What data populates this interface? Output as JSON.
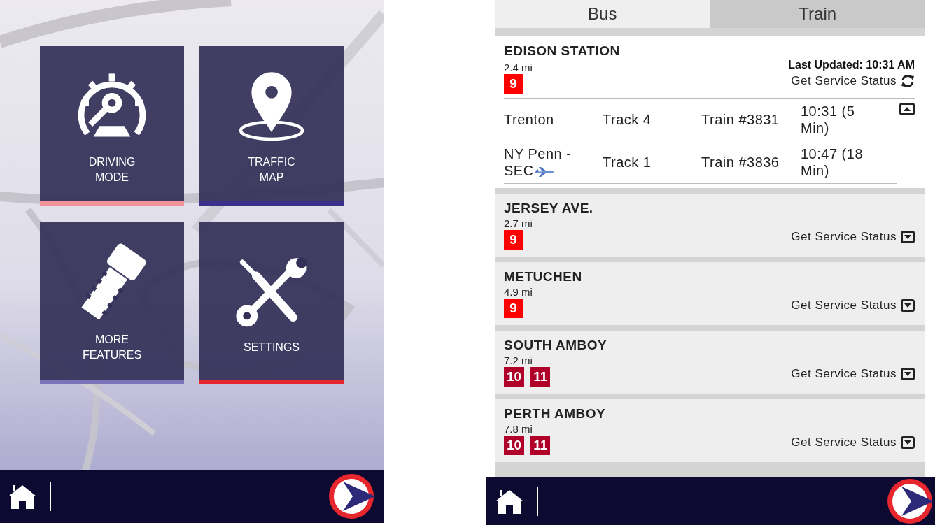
{
  "home_screen": {
    "tiles": [
      {
        "kind": "driving_mode",
        "label": "DRIVING\nMODE",
        "color": "#f0949a"
      },
      {
        "kind": "traffic_map",
        "label": "TRAFFIC\nMAP",
        "color": "#3a2f8c"
      },
      {
        "kind": "more_features",
        "label": "MORE\nFEATURES",
        "color": "#7b72b8"
      },
      {
        "kind": "settings",
        "label": "SETTINGS",
        "color": "#e8262e"
      }
    ]
  },
  "transit_screen": {
    "tabs": [
      {
        "label": "Bus",
        "selected": false
      },
      {
        "label": "Train",
        "selected": true
      }
    ],
    "stations": [
      {
        "name": "EDISON STATION",
        "distance": "2.4 mi",
        "expanded": true,
        "last_updated": "Last Updated: 10:31 AM",
        "status_label": "Get Service Status",
        "lines": [
          {
            "label": "9",
            "color": "#ff0000"
          }
        ],
        "departures": [
          {
            "destination": "Trenton",
            "airport": false,
            "track": "Track 4",
            "train": "Train #3831",
            "time": "10:31 (5 Min)"
          },
          {
            "destination": "NY Penn - SEC",
            "airport": true,
            "track": "Track 1",
            "train": "Train #3836",
            "time": "10:47 (18 Min)"
          }
        ]
      },
      {
        "name": "JERSEY AVE.",
        "distance": "2.7 mi",
        "expanded": false,
        "status_label": "Get Service Status",
        "lines": [
          {
            "label": "9",
            "color": "#ff0000"
          }
        ]
      },
      {
        "name": "METUCHEN",
        "distance": "4.9 mi",
        "expanded": false,
        "status_label": "Get Service Status",
        "lines": [
          {
            "label": "9",
            "color": "#ff0000"
          }
        ]
      },
      {
        "name": "SOUTH AMBOY",
        "distance": "7.2 mi",
        "expanded": false,
        "status_label": "Get Service Status",
        "lines": [
          {
            "label": "10",
            "color": "#b0002a"
          },
          {
            "label": "11",
            "color": "#b0002a"
          }
        ]
      },
      {
        "name": "PERTH AMBOY",
        "distance": "7.8 mi",
        "expanded": false,
        "status_label": "Get Service Status",
        "lines": [
          {
            "label": "10",
            "color": "#b0002a"
          },
          {
            "label": "11",
            "color": "#b0002a"
          }
        ]
      }
    ]
  }
}
